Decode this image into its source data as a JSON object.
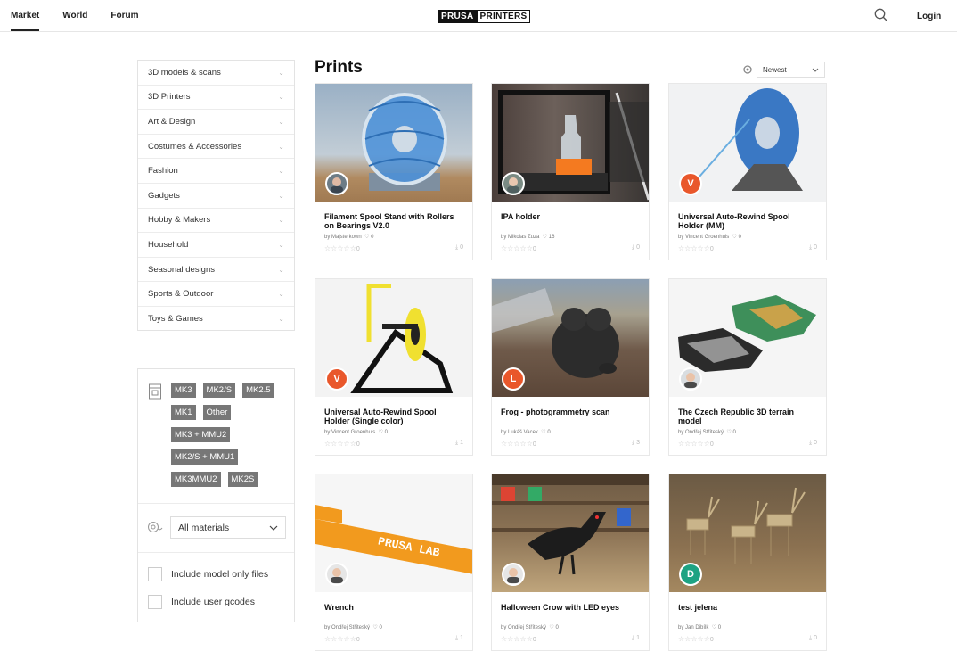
{
  "nav": {
    "items": [
      {
        "label": "Market"
      },
      {
        "label": "World"
      },
      {
        "label": "Forum"
      }
    ]
  },
  "logo": {
    "part1": "PRUSA",
    "part2": "PRINTERS"
  },
  "header": {
    "login": "Login"
  },
  "page": {
    "title": "Prints"
  },
  "sort": {
    "value": "Newest"
  },
  "categories": [
    {
      "label": "3D models & scans"
    },
    {
      "label": "3D Printers"
    },
    {
      "label": "Art & Design"
    },
    {
      "label": "Costumes & Accessories"
    },
    {
      "label": "Fashion"
    },
    {
      "label": "Gadgets"
    },
    {
      "label": "Hobby & Makers"
    },
    {
      "label": "Household"
    },
    {
      "label": "Seasonal designs"
    },
    {
      "label": "Sports & Outdoor"
    },
    {
      "label": "Toys & Games"
    }
  ],
  "printer_tags": [
    {
      "label": "MK3"
    },
    {
      "label": "MK2/S"
    },
    {
      "label": "MK2.5"
    },
    {
      "label": "MK1"
    },
    {
      "label": "Other"
    },
    {
      "label": "MK3 + MMU2"
    },
    {
      "label": "MK2/S + MMU1"
    },
    {
      "label": "MK3MMU2"
    },
    {
      "label": "MK2S"
    }
  ],
  "materials": {
    "value": "All materials"
  },
  "checkboxes": [
    {
      "label": "Include model only files"
    },
    {
      "label": "Include user gcodes"
    }
  ],
  "cards": [
    {
      "title": "Filament Spool Stand with Rollers on Bearings V2.0",
      "by": "by Majsterkown",
      "likes": "0",
      "downloads": "0",
      "rating": "0"
    },
    {
      "title": "IPA holder",
      "by": "by Mikolas Zuza",
      "likes": "16",
      "downloads": "0",
      "rating": "0"
    },
    {
      "title": "Universal Auto-Rewind Spool Holder (MM)",
      "by": "by Vincent Groenhuis",
      "likes": "0",
      "downloads": "0",
      "rating": "0",
      "avatar_letter": "V"
    },
    {
      "title": "Universal Auto-Rewind Spool Holder (Single color)",
      "by": "by Vincent Groenhuis",
      "likes": "0",
      "downloads": "1",
      "rating": "0",
      "avatar_letter": "V"
    },
    {
      "title": "Frog - photogrammetry scan",
      "by": "by Lukáš Vacek",
      "likes": "0",
      "downloads": "3",
      "rating": "0",
      "avatar_letter": "L"
    },
    {
      "title": "The Czech Republic 3D terrain model",
      "by": "by Ondřej Stříteský",
      "likes": "0",
      "downloads": "0",
      "rating": "0"
    },
    {
      "title": "Wrench",
      "by": "by Ondřej Stříteský",
      "likes": "0",
      "downloads": "1",
      "rating": "0"
    },
    {
      "title": "Halloween Crow with LED eyes",
      "by": "by Ondřej Stříteský",
      "likes": "0",
      "downloads": "1",
      "rating": "0"
    },
    {
      "title": "test jelena",
      "by": "by Jan Dibílk",
      "likes": "0",
      "downloads": "0",
      "rating": "0",
      "avatar_letter": "D"
    }
  ],
  "images": {
    "wrench_text": "PRUSA LAB"
  }
}
